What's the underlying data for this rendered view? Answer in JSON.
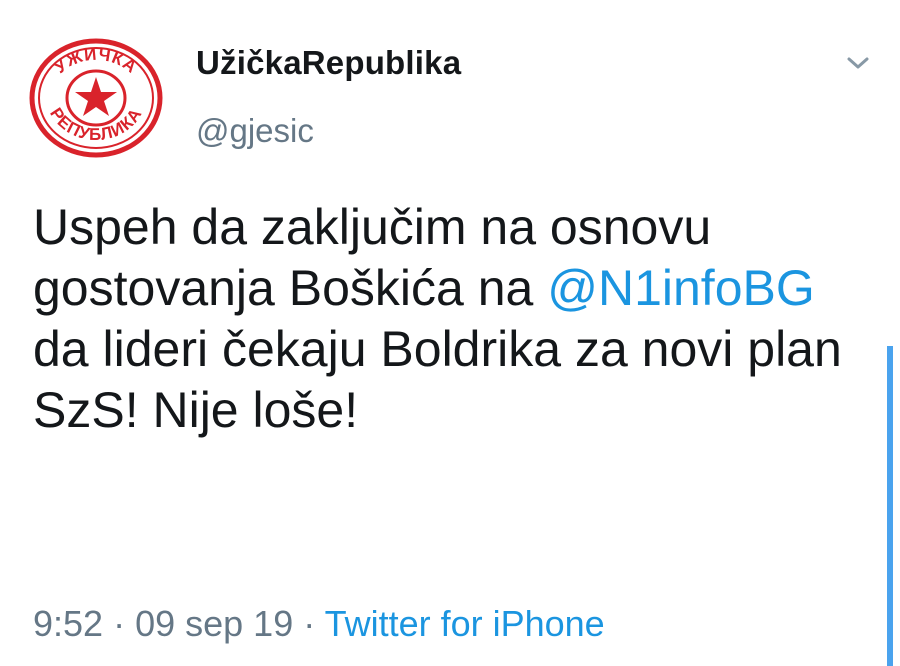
{
  "user": {
    "display_name": "UžičkaRepublika",
    "handle": "@gjesic",
    "avatar_icon": "uzicka-republika-seal-logo",
    "avatar_text": "УЖИЧКА РЕПУБЛИКА"
  },
  "tweet": {
    "text_before_mention": "Uspeh da zaključim na osnovu gostovanja Boškića na ",
    "mention": "@N1infoBG",
    "text_after_mention": " da lideri čekaju Boldrika za novi plan SzS! Nije loše!"
  },
  "meta": {
    "time": "9:52",
    "separator": " · ",
    "date": "09 sep 19",
    "source": "Twitter for iPhone"
  },
  "colors": {
    "link": "#1b95e0",
    "seal_red": "#d9232b",
    "secondary_text": "#657786",
    "scroll_indicator": "#4aa3ee"
  },
  "icons": {
    "menu": "chevron-down-icon"
  }
}
